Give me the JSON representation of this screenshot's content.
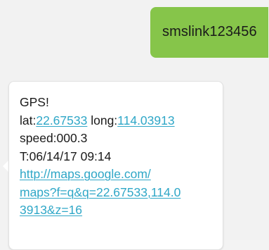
{
  "outgoing": {
    "text": "smslink123456"
  },
  "incoming": {
    "line1": "GPS!",
    "lat_label": "lat:",
    "lat_value": "22.67533",
    "long_label": " long:",
    "long_value": "114.03913",
    "speed": "speed:000.3",
    "time": "T:06/14/17 09:14",
    "url_line1": "http://maps.google.com/",
    "url_line2": "maps?f=q&q=22.67533,114.0",
    "url_line3": "3913&z=16"
  },
  "colors": {
    "outgoing_bubble": "#86c54a",
    "link": "#2fa7c7",
    "background": "#f2f2f2"
  }
}
